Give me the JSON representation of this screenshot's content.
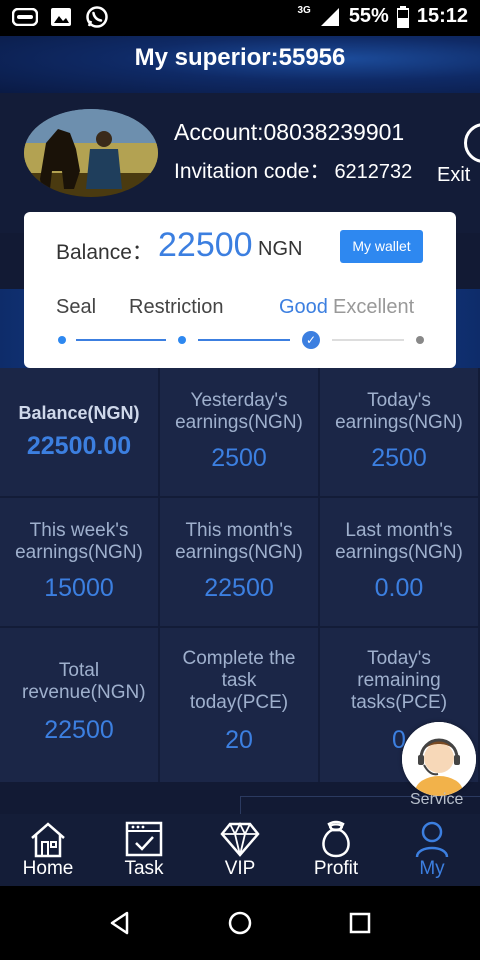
{
  "status_bar": {
    "left_icons": [
      "toggle-icon",
      "image-icon",
      "whatsapp-icon"
    ],
    "network": "3G",
    "battery_pct": "55%",
    "time": "15:12"
  },
  "header": {
    "superior": "My superior:55956"
  },
  "profile": {
    "account": "Account:08038239901",
    "invite_label": "Invitation code：",
    "invite_code": "6212732",
    "exit_label": "Exit"
  },
  "balance_card": {
    "label": "Balance：",
    "value": "22500",
    "unit": "NGN",
    "wallet_button": "My wallet",
    "levels": [
      "Seal",
      "Restriction",
      "Good",
      "Excellent"
    ],
    "current_level": "Good"
  },
  "stats": [
    {
      "label": "Balance(NGN)",
      "value": "22500.00"
    },
    {
      "label": "Yesterday's earnings(NGN)",
      "value": "2500"
    },
    {
      "label": "Today's earnings(NGN)",
      "value": "2500"
    },
    {
      "label": "This week's earnings(NGN)",
      "value": "15000"
    },
    {
      "label": "This month's earnings(NGN)",
      "value": "22500"
    },
    {
      "label": "Last month's earnings(NGN)",
      "value": "0.00"
    },
    {
      "label": "Total revenue(NGN)",
      "value": "22500"
    },
    {
      "label": "Complete the task today(PCE)",
      "value": "20"
    },
    {
      "label": "Today's remaining tasks(PCE)",
      "value": "0"
    }
  ],
  "service": {
    "label": "Service"
  },
  "bottom_nav": [
    {
      "label": "Home",
      "icon": "home-icon"
    },
    {
      "label": "Task",
      "icon": "task-icon"
    },
    {
      "label": "VIP",
      "icon": "diamond-icon"
    },
    {
      "label": "Profit",
      "icon": "money-bag-icon"
    },
    {
      "label": "My",
      "icon": "user-icon",
      "active": true
    }
  ],
  "colors": {
    "accent": "#3c7fe0",
    "background": "#121a34",
    "cell": "#1b2647",
    "button": "#2e88f0"
  }
}
